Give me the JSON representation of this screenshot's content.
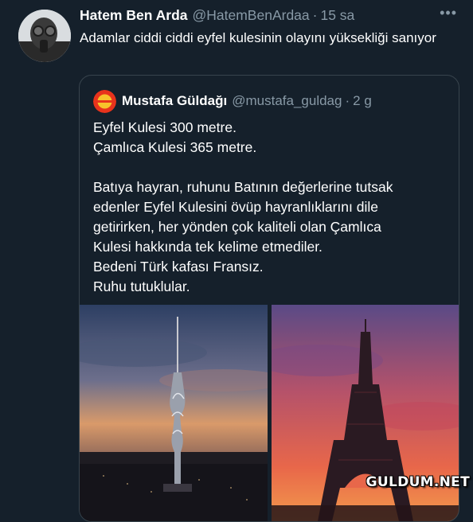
{
  "tweet": {
    "author_name": "Hatem Ben Arda",
    "author_handle": "@HatemBenArdaa",
    "separator": "·",
    "time": "15 sa",
    "more": "•••",
    "text": "Adamlar ciddi ciddi eyfel kulesinin olayını yüksekliği sanıyor"
  },
  "quoted": {
    "author_name": "Mustafa Güldağı",
    "author_handle": "@mustafa_guldag",
    "separator": "·",
    "time": "2 g",
    "lines": [
      "Eyfel Kulesi 300 metre.",
      "Çamlıca Kulesi 365 metre.",
      "Batıya hayran, ruhunu Batının değerlerine tutsak",
      "edenler Eyfel Kulesini övüp hayranlıklarını dile",
      "getirirken, her yönden çok kaliteli olan Çamlıca",
      "Kulesi hakkında tek kelime etmediler.",
      "Bedeni Türk kafası Fransız.",
      "Ruhu tutuklular."
    ]
  },
  "watermark": "GULDUM.NET",
  "colors": {
    "background": "#15202b",
    "border": "#38444d",
    "secondary_text": "#8899a6"
  }
}
